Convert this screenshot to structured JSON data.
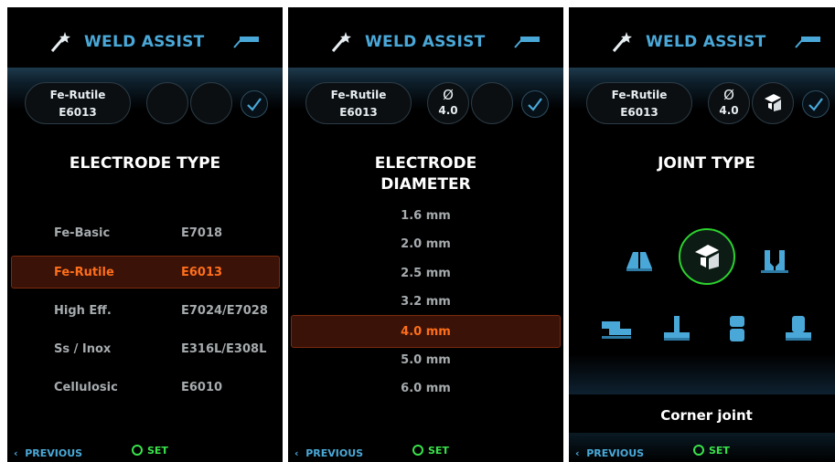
{
  "app_title": "WELD ASSIST",
  "colors": {
    "accent": "#4aa8d8",
    "selected": "#ff6e1a",
    "selected_bg": "#3a1207",
    "set_green": "#39e34a"
  },
  "icons": {
    "brand": "wand-icon",
    "torch": "torch-icon",
    "confirm": "check-icon",
    "diameter": "diameter-icon"
  },
  "panels": [
    {
      "summary": {
        "electrode_group": "Fe-Rutile",
        "electrode_code": "E6013",
        "diameter_symbol": "",
        "diameter": "",
        "joint_icon": ""
      },
      "heading": "ELECTRODE TYPE",
      "options": [
        {
          "name": "Fe-Basic",
          "code": "E7018",
          "selected": false
        },
        {
          "name": "Fe-Rutile",
          "code": "E6013",
          "selected": true
        },
        {
          "name": "High Eff.",
          "code": "E7024/E7028",
          "selected": false
        },
        {
          "name": "Ss / Inox",
          "code": "E316L/E308L",
          "selected": false
        },
        {
          "name": "Cellulosic",
          "code": "E6010",
          "selected": false
        }
      ],
      "footer": {
        "previous": "PREVIOUS",
        "set": "SET"
      }
    },
    {
      "summary": {
        "electrode_group": "Fe-Rutile",
        "electrode_code": "E6013",
        "diameter_symbol": "Ø",
        "diameter": "4.0"
      },
      "heading_line1": "ELECTRODE",
      "heading_line2": "DIAMETER",
      "options": [
        "1.6 mm",
        "2.0 mm",
        "2.5 mm",
        "3.2 mm",
        "4.0 mm",
        "5.0 mm",
        "6.0 mm"
      ],
      "selected": "4.0 mm",
      "footer": {
        "previous": "PREVIOUS",
        "set": "SET"
      }
    },
    {
      "summary": {
        "electrode_group": "Fe-Rutile",
        "electrode_code": "E6013",
        "diameter_symbol": "Ø",
        "diameter": "4.0",
        "joint_icon": "corner-joint-icon"
      },
      "heading": "JOINT TYPE",
      "joints": [
        "butt-joint-icon",
        "corner-joint-icon",
        "edge-joint-icon",
        "lap-joint-icon",
        "tee-joint-icon",
        "pipe-butt-joint-icon",
        "pipe-flange-joint-icon"
      ],
      "selected_joint": "corner-joint-icon",
      "selected_label": "Corner joint",
      "footer": {
        "previous": "PREVIOUS",
        "set": "SET"
      }
    }
  ]
}
